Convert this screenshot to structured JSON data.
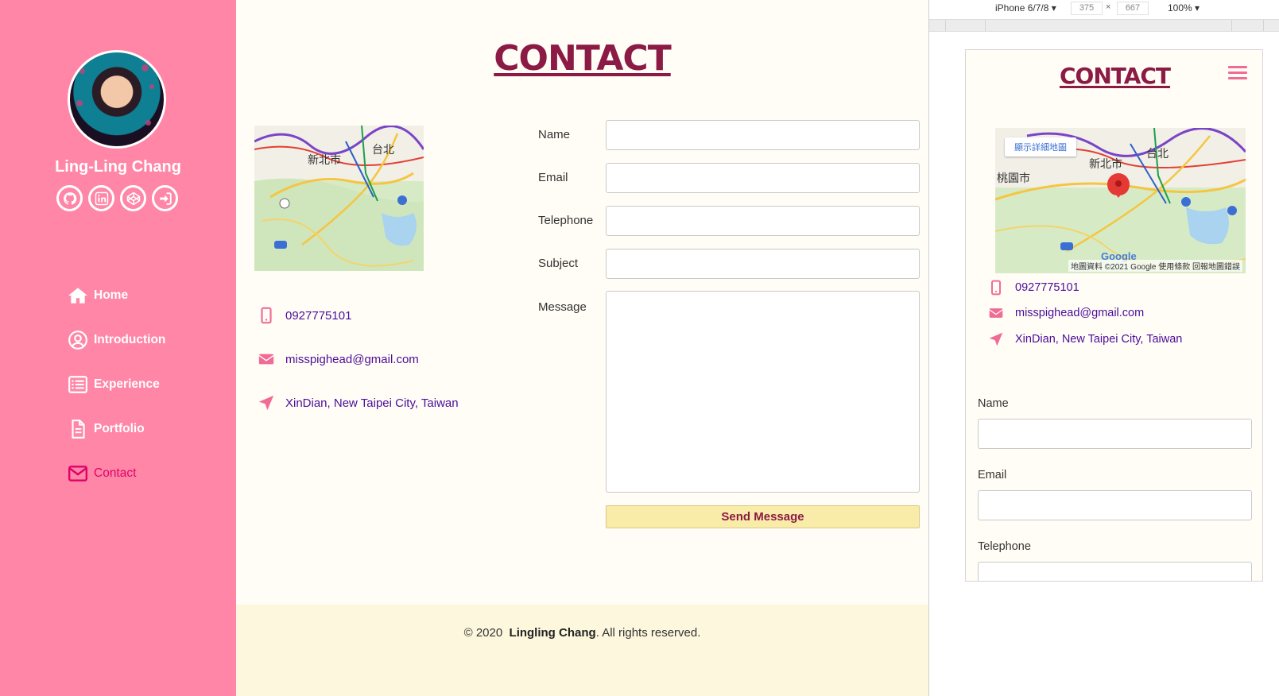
{
  "sidebar": {
    "name": "Ling-Ling Chang",
    "socials": [
      {
        "icon": "github-icon"
      },
      {
        "icon": "linkedin-icon"
      },
      {
        "icon": "codepen-icon"
      },
      {
        "icon": "sign-in-icon"
      }
    ],
    "nav": [
      {
        "label": "Home",
        "icon": "home-icon"
      },
      {
        "label": "Introduction",
        "icon": "user-circle-icon"
      },
      {
        "label": "Experience",
        "icon": "list-icon"
      },
      {
        "label": "Portfolio",
        "icon": "file-icon"
      },
      {
        "label": "Contact",
        "icon": "envelope-icon",
        "active": true
      }
    ]
  },
  "main": {
    "title": "CONTACT",
    "map_labels": {
      "city1": "新北市",
      "city2": "台北"
    },
    "contact": {
      "phone": "0927775101",
      "email": "misspighead@gmail.com",
      "location": "XinDian, New Taipei City, Taiwan"
    },
    "form": {
      "name_label": "Name",
      "email_label": "Email",
      "telephone_label": "Telephone",
      "subject_label": "Subject",
      "message_label": "Message",
      "send_label": "Send Message"
    },
    "footer": {
      "prefix": "© 2020",
      "owner": "Lingling Chang",
      "suffix": ". All rights reserved."
    }
  },
  "devtools": {
    "device": "iPhone 6/7/8 ▾",
    "width": "375",
    "x": "×",
    "height": "667",
    "zoom": "100% ▾"
  },
  "mobile": {
    "title": "CONTACT",
    "map_button": "顯示詳細地圖",
    "map_attribution": "地圖資料 ©2021 Google   使用條款   回報地圖錯誤",
    "map_google": "Google",
    "map_labels": {
      "city1": "新北市",
      "city2": "台北",
      "city3": "桃園市"
    },
    "phone": "0927775101",
    "email": "misspighead@gmail.com",
    "location": "XinDian, New Taipei City, Taiwan",
    "name_label": "Name",
    "email_label": "Email",
    "telephone_label": "Telephone"
  },
  "colors": {
    "sidebar_bg": "#ff86a6",
    "accent": "#8b1a45",
    "link": "#4a0d9b",
    "icon_pink": "#f06c96",
    "button_bg": "#f9eca8"
  }
}
